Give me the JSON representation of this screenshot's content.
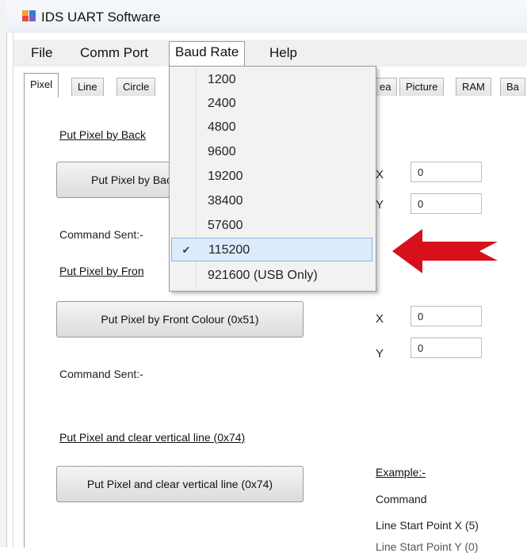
{
  "window": {
    "title": "IDS UART Software"
  },
  "menu": {
    "items": [
      "File",
      "Comm Port",
      "Baud Rate",
      "Help"
    ],
    "open_item": "Baud Rate"
  },
  "tabs": [
    "Pixel",
    "Line",
    "Circle",
    "ea",
    "Picture",
    "RAM",
    "Ba"
  ],
  "active_tab": "Pixel",
  "baud_dropdown": {
    "options": [
      "1200",
      "2400",
      "4800",
      "9600",
      "19200",
      "38400",
      "57600",
      "115200",
      "921600 (USB Only)"
    ],
    "selected": "115200",
    "check_glyph": "✔"
  },
  "content": {
    "section1": {
      "title": "Put Pixel by Back",
      "button": "Put Pixel by Bac",
      "x_label": "X",
      "x_value": "0",
      "y_label": "Y",
      "y_value": "0",
      "command_sent": "Command Sent:-"
    },
    "section2": {
      "title": "Put Pixel by Fron",
      "button": "Put Pixel by Front Colour (0x51)",
      "x_label": "X",
      "x_value": "0",
      "y_label": "Y",
      "y_value": "0",
      "command_sent": "Command Sent:-"
    },
    "section3": {
      "title": "Put Pixel and clear vertical line (0x74)",
      "button": "Put Pixel and clear vertical line (0x74)",
      "example_label": "Example:-",
      "command_label": "Command",
      "line_x": "Line Start Point X (5)",
      "line_y_partial": "Line Start Point Y (0)"
    }
  },
  "colors": {
    "arrow": "#d7111b",
    "highlight": "#dcebfb",
    "highlight_border": "#8ab5e6"
  },
  "icons": {
    "app": "app-icon",
    "check": "check-icon",
    "arrow": "red-arrow-icon"
  }
}
